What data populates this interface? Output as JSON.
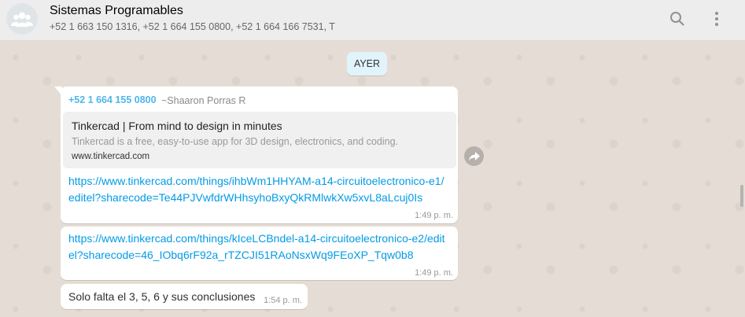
{
  "header": {
    "title": "Sistemas Programables",
    "subtitle": "+52 1 663 150 1316, +52 1 664 155 0800, +52 1 664 166 7531, T",
    "icons": {
      "avatar": "group-avatar-icon",
      "search": "search-icon",
      "menu": "kebab-menu-icon"
    }
  },
  "date_divider": "AYER",
  "messages": [
    {
      "sender_phone": "+52 1 664 155 0800",
      "sender_name": "~Shaaron Porras R",
      "preview": {
        "title": "Tinkercad | From mind to design in minutes",
        "description": "Tinkercad is a free, easy-to-use app for 3D design, electronics, and coding.",
        "domain": "www.tinkercad.com"
      },
      "text": "https://www.tinkercad.com/things/ihbWm1HHYAM-a14-circuitoelectronico-e1/editel?sharecode=Te44PJVwfdrWHhsyhoBxyQkRMlwkXw5xvL8aLcuj0Is",
      "time": "1:49 p. m."
    },
    {
      "text": "https://www.tinkercad.com/things/kIceLCBndel-a14-circuitoelectronico-e2/editel?sharecode=46_IObq6rF92a_rTZCJI51RAoNsxWq9FEoXP_Tqw0b8",
      "time": "1:49 p. m."
    },
    {
      "text": "Solo falta el 3, 5, 6 y sus conclusiones",
      "time": "1:54 p. m."
    }
  ],
  "colors": {
    "header_bg": "#ededed",
    "chat_bg": "#e5ddd5",
    "link": "#039be5",
    "sender": "#4fb6ec",
    "date_chip": "#e1f3fb"
  }
}
